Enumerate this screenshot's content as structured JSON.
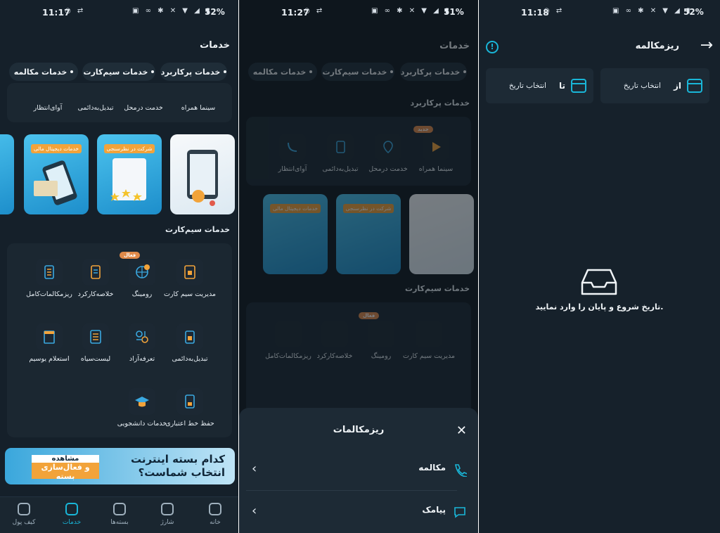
{
  "status": {
    "left": {
      "time": "11:17",
      "battery": "52%"
    },
    "middle": {
      "time": "11:27",
      "battery": "51%"
    },
    "right": {
      "time": "11:18",
      "battery": "52%"
    }
  },
  "services_page": {
    "title": "خدمات",
    "chips": [
      "خدمات پرکاربرد",
      "خدمات سیم‌کارت",
      "خدمات مکالمه"
    ],
    "popular_title": "خدمات پرکاربرد",
    "popular_items": [
      "سینما همراه",
      "خدمت درمحل",
      "تبدیل‌به‌دائمی",
      "آوای‌انتظار"
    ],
    "new_badge": "جدید",
    "banners": [
      "خدمات دیجیتال مالی",
      "شرکت در نظرسنجی"
    ],
    "sim_title": "خدمات سیم‌کارت",
    "sim_items": [
      "مدیریت سیم کارت",
      "رومینگ",
      "خلاصه‌کارکرد",
      "ریزمکالمات‌کامل",
      "تبدیل‌به‌دائمی",
      "تعرفه‌آزاد",
      "لیست‌سیاه",
      "استعلام یوسیم",
      "حفظ خط اعتباری",
      "خدمات دانشجویی"
    ],
    "active_badge": "فعال",
    "promo": {
      "line1": "کدام بسته اینترنت",
      "line2": "انتخاب شماست؟",
      "btn_top": "مشاهده",
      "btn_bottom": "و فعال‌سازی بسته"
    },
    "nav": [
      "خانه",
      "شارژ",
      "بسته‌ها",
      "خدمات",
      "کیف پول"
    ]
  },
  "sheet": {
    "title": "ریزمکالمات",
    "rows": [
      "مکالمه",
      "پیامک"
    ]
  },
  "detail_page": {
    "title": "ریزمکالمه",
    "from_label": "از",
    "to_label": "تا",
    "pick_date": "انتخاب تاریخ",
    "empty_message": "تاریخ شروع و پایان را وارد نمایید."
  },
  "colors": {
    "accent": "#19b6d8",
    "badge": "#e08a4a",
    "bg": "#15202a"
  }
}
